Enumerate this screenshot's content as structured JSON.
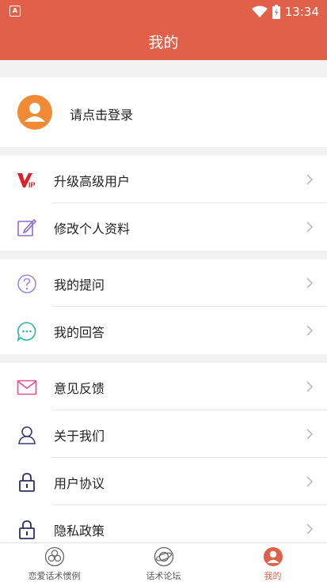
{
  "status_bar": {
    "time": "13:34",
    "notification_icon": "a-icon"
  },
  "app_bar": {
    "title": "我的"
  },
  "profile": {
    "login_text": "请点击登录"
  },
  "groups": [
    {
      "items": [
        {
          "label": "升级高级用户",
          "icon": "vip-icon"
        },
        {
          "label": "修改个人资料",
          "icon": "edit-icon"
        }
      ]
    },
    {
      "items": [
        {
          "label": "我的提问",
          "icon": "question-icon"
        },
        {
          "label": "我的回答",
          "icon": "chat-icon"
        }
      ]
    },
    {
      "items": [
        {
          "label": "意见反馈",
          "icon": "mail-icon"
        },
        {
          "label": "关于我们",
          "icon": "person-icon"
        },
        {
          "label": "用户协议",
          "icon": "lock-icon"
        },
        {
          "label": "隐私政策",
          "icon": "lock-icon"
        }
      ]
    }
  ],
  "tabs": [
    {
      "label": "恋爱话术惯例",
      "icon": "flower-icon",
      "active": false
    },
    {
      "label": "话术论坛",
      "icon": "planet-icon",
      "active": false
    },
    {
      "label": "我的",
      "icon": "user-icon",
      "active": true
    }
  ],
  "colors": {
    "accent": "#e0604a",
    "avatar": "#f08a35"
  }
}
